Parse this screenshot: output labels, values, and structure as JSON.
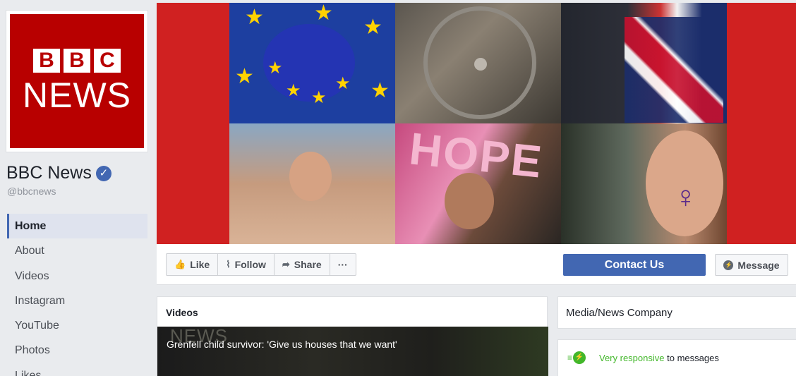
{
  "profile": {
    "logo_blocks": [
      "B",
      "B",
      "C"
    ],
    "logo_word": "NEWS",
    "name": "BBC News",
    "verified_glyph": "✓",
    "handle": "@bbcnews"
  },
  "nav": {
    "items": [
      {
        "label": "Home",
        "active": true
      },
      {
        "label": "About"
      },
      {
        "label": "Videos"
      },
      {
        "label": "Instagram"
      },
      {
        "label": "YouTube"
      },
      {
        "label": "Photos"
      },
      {
        "label": "Likes"
      }
    ]
  },
  "cover": {
    "hope_text": "HOPE",
    "venus_glyph": "♀"
  },
  "actions": {
    "like": {
      "label": "Like",
      "icon": "thumbs-up-icon",
      "glyph": "👍"
    },
    "follow": {
      "label": "Follow",
      "icon": "rss-icon",
      "glyph": "⌇"
    },
    "share": {
      "label": "Share",
      "icon": "share-arrow-icon",
      "glyph": "➦"
    },
    "more": {
      "label": "···",
      "icon": "more-icon"
    },
    "contact_label": "Contact Us",
    "message_label": "Message",
    "message_icon_glyph": "⚡"
  },
  "videos_panel": {
    "title": "Videos",
    "thumb_overlay": "NEWS",
    "caption": "Grenfell child survivor: 'Give us houses that we want'"
  },
  "about_panel": {
    "category": "Media/News Company",
    "responsive_icon_glyph": "≡",
    "responsive_bubble_glyph": "⚡",
    "responsive_strong": "Very responsive",
    "responsive_rest": " to messages"
  },
  "colors": {
    "brand_blue": "#4267b2",
    "bbc_red": "#b80000",
    "cover_red": "#d02121",
    "responsive_green": "#42b72a"
  }
}
